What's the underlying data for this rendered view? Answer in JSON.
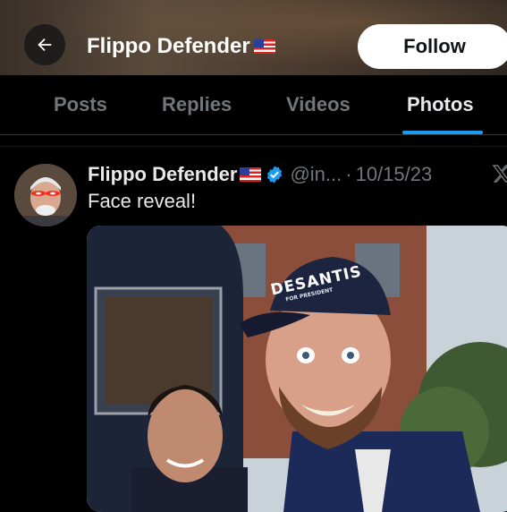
{
  "header": {
    "title": "Flippo Defender",
    "title_emoji": "us-flag",
    "back_icon": "arrow-left-icon",
    "follow_label": "Follow"
  },
  "tabs": [
    {
      "label": "Posts",
      "active": false
    },
    {
      "label": "Replies",
      "active": false
    },
    {
      "label": "Videos",
      "active": false
    },
    {
      "label": "Photos",
      "active": true
    }
  ],
  "post": {
    "author": "Flippo Defender",
    "author_emoji": "us-flag",
    "verified": true,
    "handle": "@in...",
    "separator": "·",
    "date": "10/15/23",
    "text": "Face reveal!",
    "photo": {
      "cap_text": "DESANTIS",
      "cap_subtext": "FOR PRESIDENT"
    }
  },
  "colors": {
    "accent": "#1d9bf0",
    "background": "#000000",
    "text": "#e7e9ea",
    "muted": "#71767b"
  }
}
